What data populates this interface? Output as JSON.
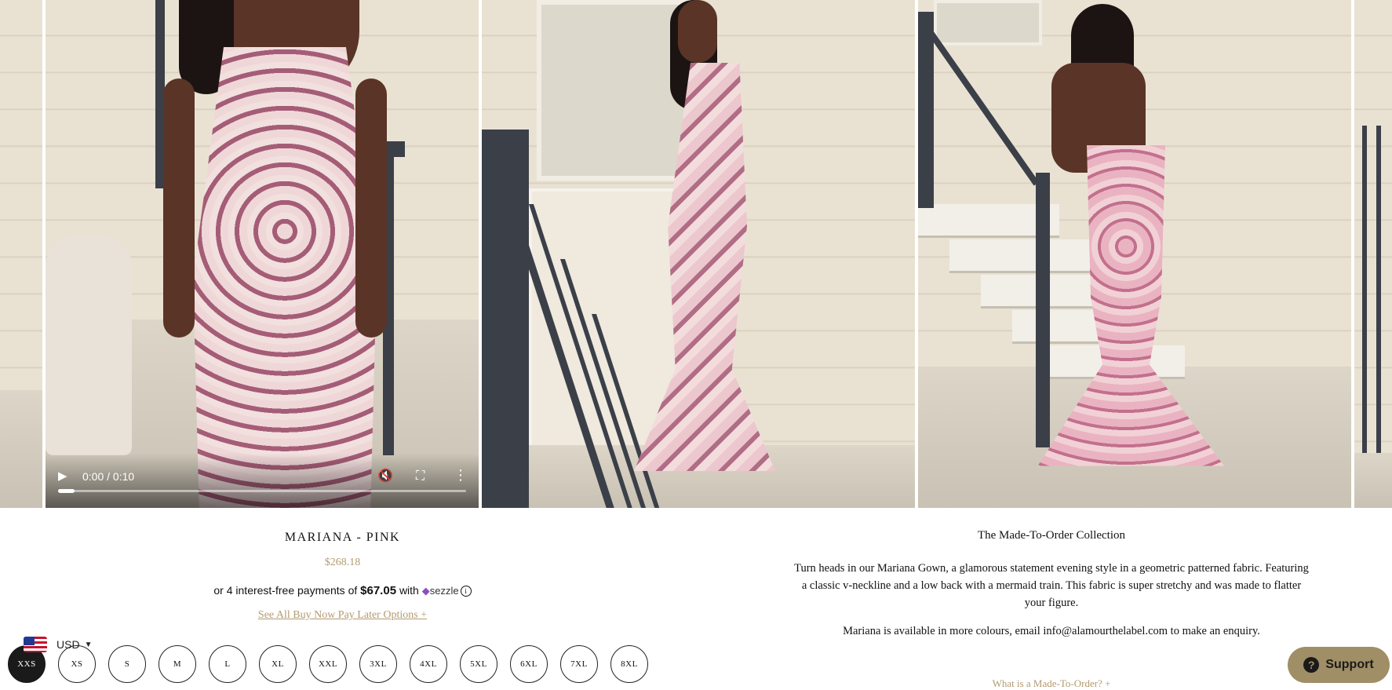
{
  "video": {
    "time": "0:00 / 0:10",
    "progress": 0.04,
    "play_icon": "▶",
    "mute_icon": "🔇",
    "fullscreen_icon": "⛶",
    "menu_icon": "⋮"
  },
  "product": {
    "title": "MARIANA - PINK",
    "price": "$268.18",
    "installment_prefix": "or 4 interest-free payments of",
    "installment_amount": "$67.05",
    "installment_with": "with",
    "sezzle_brand": "sezzle",
    "info_glyph": "i",
    "bnpl_link": "See All Buy Now Pay Later Options +"
  },
  "sizes": [
    {
      "label": "XXS",
      "selected": true
    },
    {
      "label": "XS",
      "selected": false
    },
    {
      "label": "S",
      "selected": false
    },
    {
      "label": "M",
      "selected": false
    },
    {
      "label": "L",
      "selected": false
    },
    {
      "label": "XL",
      "selected": false
    },
    {
      "label": "XXL",
      "selected": false
    },
    {
      "label": "3XL",
      "selected": false
    },
    {
      "label": "4XL",
      "selected": false
    },
    {
      "label": "5XL",
      "selected": false
    },
    {
      "label": "6XL",
      "selected": false
    },
    {
      "label": "7XL",
      "selected": false
    },
    {
      "label": "8XL",
      "selected": false
    }
  ],
  "currency": {
    "code": "USD",
    "caret": "▼"
  },
  "description": {
    "heading": "The Made-To-Order Collection",
    "body": "Turn heads in our Mariana Gown, a glamorous statement evening style in a geometric patterned fabric. Featuring a classic v-neckline and a low back with a mermaid train. This fabric is super stretchy and was made to flatter your figure.",
    "colours": "Mariana is available in more colours, email info@alamourthelabel.com to make an enquiry.",
    "link": "What is a Made-To-Order? +"
  },
  "support": {
    "label": "Support",
    "icon_glyph": "?"
  },
  "colors": {
    "accent_gold": "#b39a6f",
    "support_bg": "#a08e66",
    "dress_pink": "#e7b7c1"
  }
}
